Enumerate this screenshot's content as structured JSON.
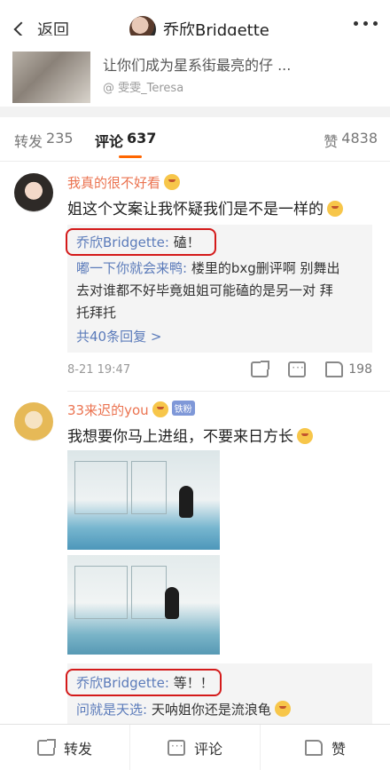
{
  "nav": {
    "back_label": "返回",
    "title": "乔欣Bridgette"
  },
  "post": {
    "text": "让你们成为星系街最亮的仔 ...",
    "author": "@ 雯雯_Teresa"
  },
  "tabs": {
    "forward_label": "转发",
    "forward_count": "235",
    "comment_label": "评论",
    "comment_count": "637",
    "like_label": "赞",
    "like_count": "4838"
  },
  "comments": [
    {
      "name": "我真的很不好看",
      "text": "姐这个文案让我怀疑我们是不是一样的",
      "replies": [
        {
          "name": "乔欣Bridgette:",
          "text": "磕！"
        },
        {
          "name": "嘟一下你就会来鸭:",
          "text": "楼里的bxg删评啊 别舞出"
        },
        {
          "text": "去对谁都不好毕竟姐姐可能磕的是另一对 拜"
        },
        {
          "text": "托拜托"
        }
      ],
      "more_replies": "共40条回复 >",
      "time": "8-21 19:47",
      "like_count": "198"
    },
    {
      "name": "33来迟的you",
      "badge": "铁粉",
      "text": "我想要你马上进组，不要来日方长",
      "replies": [
        {
          "name": "乔欣Bridgette:",
          "text": "等！！"
        },
        {
          "name": "问就是天选:",
          "text": "天呐姐你还是流浪龟"
        }
      ]
    }
  ],
  "bottom": {
    "forward_label": "转发",
    "comment_label": "评论",
    "like_label": "赞"
  },
  "colors": {
    "username": "#eb7350",
    "link": "#5b7bba",
    "highlight": "#d41a1a",
    "tab_underline": "#ff6600"
  }
}
